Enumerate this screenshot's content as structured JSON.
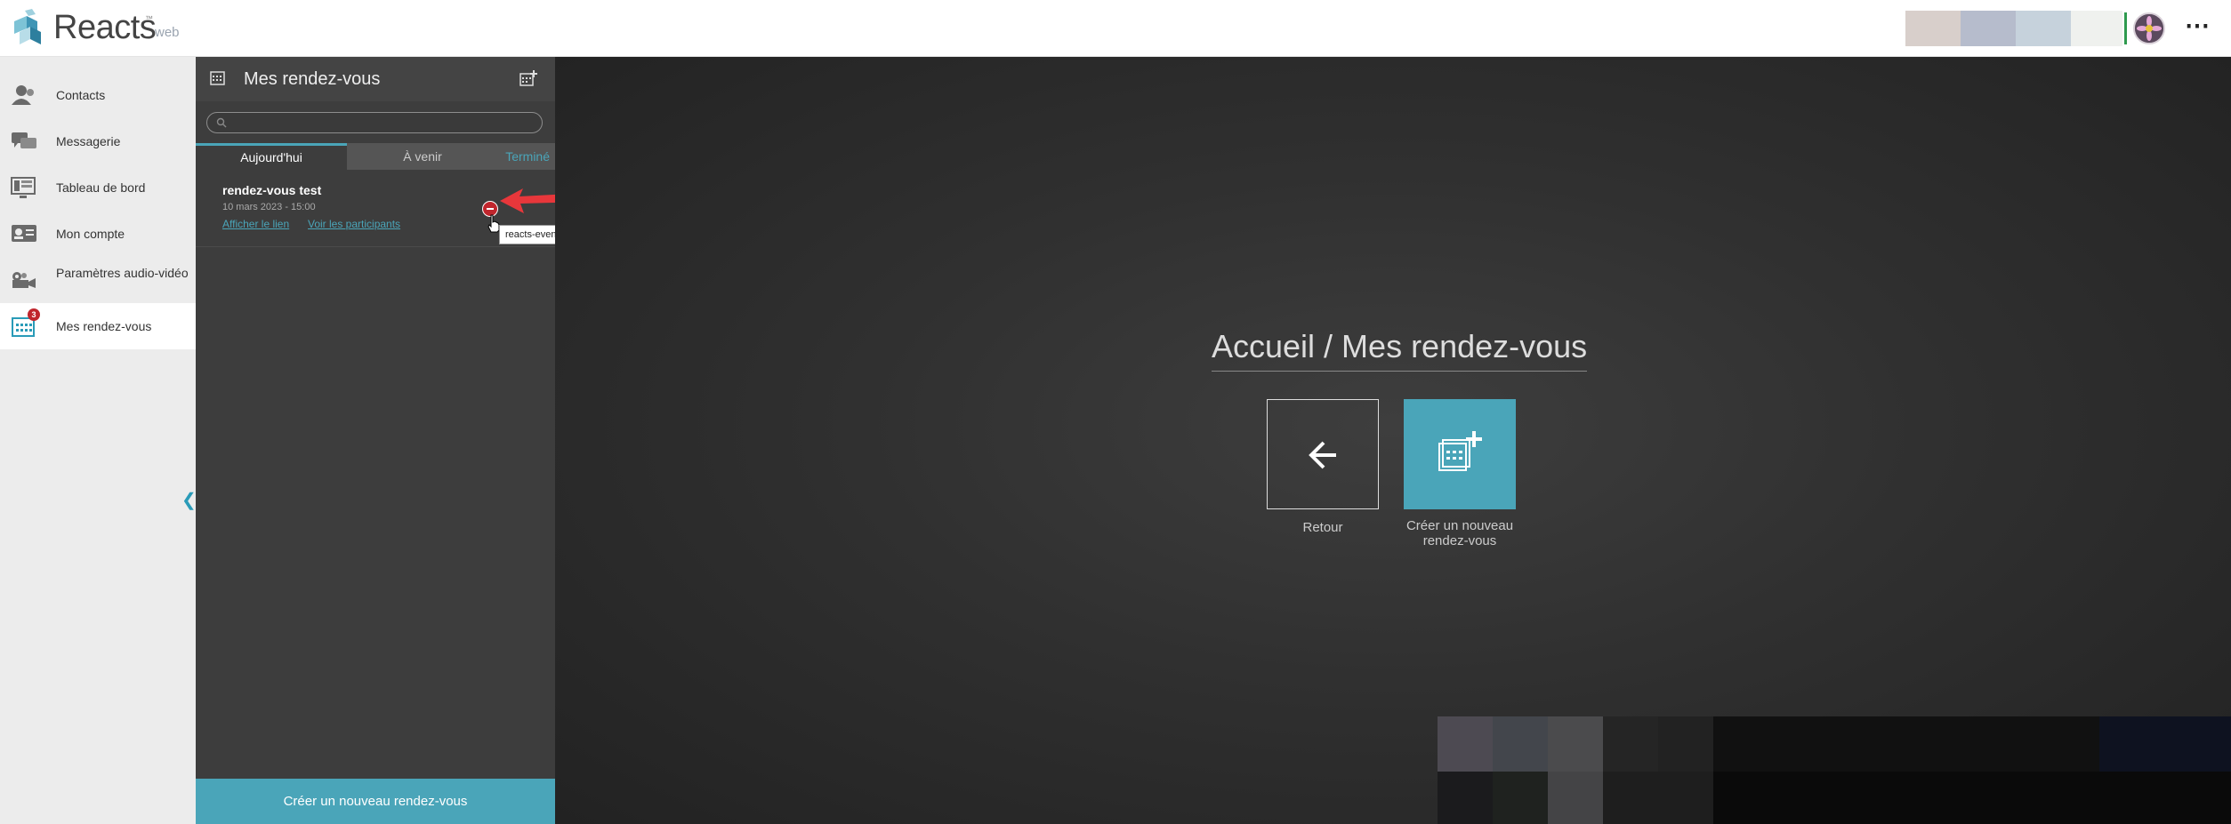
{
  "header": {
    "brand": "Reacts",
    "brand_tm": "™",
    "brand_suffix": "web",
    "more_label": "⋯"
  },
  "nav": {
    "items": [
      {
        "label": "Contacts",
        "icon": "contacts-icon"
      },
      {
        "label": "Messagerie",
        "icon": "chat-icon"
      },
      {
        "label": "Tableau de bord",
        "icon": "dashboard-icon"
      },
      {
        "label": "Mon compte",
        "icon": "account-card-icon"
      },
      {
        "label": "Paramètres audio-vidéo",
        "icon": "video-camera-icon"
      },
      {
        "label": "Mes rendez-vous",
        "icon": "calendar-icon",
        "badge": "3"
      }
    ],
    "collapse_label": "❮"
  },
  "panel": {
    "title": "Mes rendez-vous",
    "search_placeholder": "",
    "tabs": [
      "Aujourd'hui",
      "À venir",
      "Terminé"
    ],
    "events": [
      {
        "title": "rendez-vous test",
        "date": "10 mars 2023 - 15:00",
        "link1": "Afficher le lien",
        "link2": "Voir les participants"
      }
    ],
    "tooltip": "reacts-event-rendez-vous test",
    "create_button": "Créer un nouveau rendez-vous"
  },
  "main": {
    "breadcrumb": "Accueil / Mes rendez-vous",
    "back_label": "Retour",
    "new_label_line1": "Créer un nouveau",
    "new_label_line2": "rendez-vous"
  },
  "colors": {
    "accent": "#4aa5b9",
    "danger": "#c0262d",
    "panel": "#3d3d3d"
  }
}
